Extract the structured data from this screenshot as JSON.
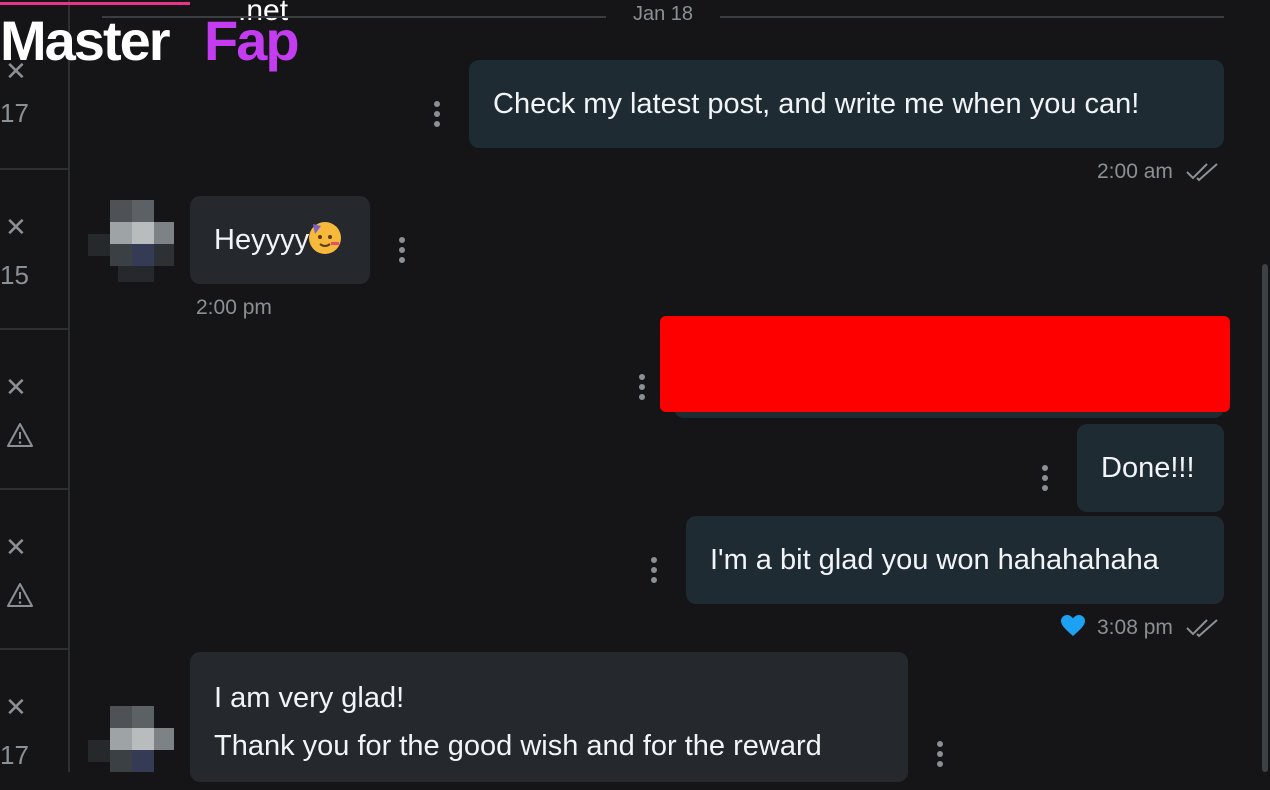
{
  "brand": {
    "master": "Master",
    "fap": "Fap",
    "net": ".net"
  },
  "sidebar": {
    "counts": [
      "17",
      "15",
      "17"
    ]
  },
  "chat": {
    "date_divider": "Jan 18",
    "messages": [
      {
        "direction": "out",
        "text": "Check my latest post, and write me when you can!",
        "time": "2:00 am",
        "status": "read"
      },
      {
        "direction": "in",
        "text": "Heyyyy",
        "emoji": "partying-face",
        "time": "2:00 pm"
      },
      {
        "direction": "out",
        "text": "",
        "redacted": true
      },
      {
        "direction": "out",
        "text": "Done!!!"
      },
      {
        "direction": "out",
        "text": "I'm a bit glad you won hahahahaha",
        "time": "3:08 pm",
        "liked": true,
        "status": "read"
      },
      {
        "direction": "in",
        "lines": [
          "I am very glad!",
          "Thank you for the good wish and for the reward"
        ]
      }
    ]
  },
  "colors": {
    "background": "#151517",
    "outgoing_bubble": "#1f2b32",
    "incoming_bubble": "#25282c",
    "redaction": "#ff0000",
    "like_heart": "#1da1f2",
    "brand_pink": "#e8358a"
  }
}
